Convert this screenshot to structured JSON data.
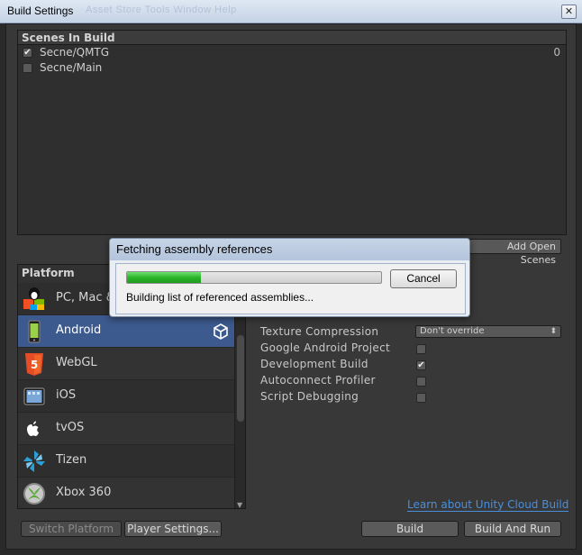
{
  "window": {
    "title": "Build Settings",
    "background_menu_ghost": "Asset Store   Tools   Window   Help",
    "close_glyph": "✕"
  },
  "scenes": {
    "header": "Scenes In Build",
    "items": [
      {
        "name": "Secne/QMTG",
        "checked": true,
        "index": "0"
      },
      {
        "name": "Secne/Main",
        "checked": false,
        "index": ""
      }
    ],
    "add_open_scenes_label": "Add Open Scenes"
  },
  "platform": {
    "header": "Platform",
    "items": [
      {
        "label": "PC, Mac & Linux Standalone",
        "icon": "pc-mac-linux-icon",
        "selected": false,
        "active": false
      },
      {
        "label": "Android",
        "icon": "android-icon",
        "selected": true,
        "active": true
      },
      {
        "label": "WebGL",
        "icon": "html5-icon",
        "selected": false,
        "active": false
      },
      {
        "label": "iOS",
        "icon": "ios-icon",
        "selected": false,
        "active": false
      },
      {
        "label": "tvOS",
        "icon": "apple-tv-icon",
        "selected": false,
        "active": false
      },
      {
        "label": "Tizen",
        "icon": "tizen-icon",
        "selected": false,
        "active": false
      },
      {
        "label": "Xbox 360",
        "icon": "xbox-icon",
        "selected": false,
        "active": false
      }
    ]
  },
  "android_settings": {
    "texture_compression_label": "Texture Compression",
    "texture_compression_value": "Don't override",
    "google_android_project_label": "Google Android Project",
    "google_android_project": false,
    "development_build_label": "Development Build",
    "development_build": true,
    "autoconnect_profiler_label": "Autoconnect Profiler",
    "autoconnect_profiler": false,
    "script_debugging_label": "Script Debugging",
    "script_debugging": false
  },
  "cloud_build_link": "Learn about Unity Cloud Build",
  "buttons": {
    "switch_platform": "Switch Platform",
    "player_settings": "Player Settings...",
    "build": "Build",
    "build_and_run": "Build And Run"
  },
  "progress_dialog": {
    "title": "Fetching assembly references",
    "status": "Building list of referenced assemblies...",
    "cancel": "Cancel",
    "progress": 0.29
  },
  "colors": {
    "selected_row": "#3d5a8e",
    "link": "#4a8fdc",
    "progress_fill": "#2bb52b"
  }
}
